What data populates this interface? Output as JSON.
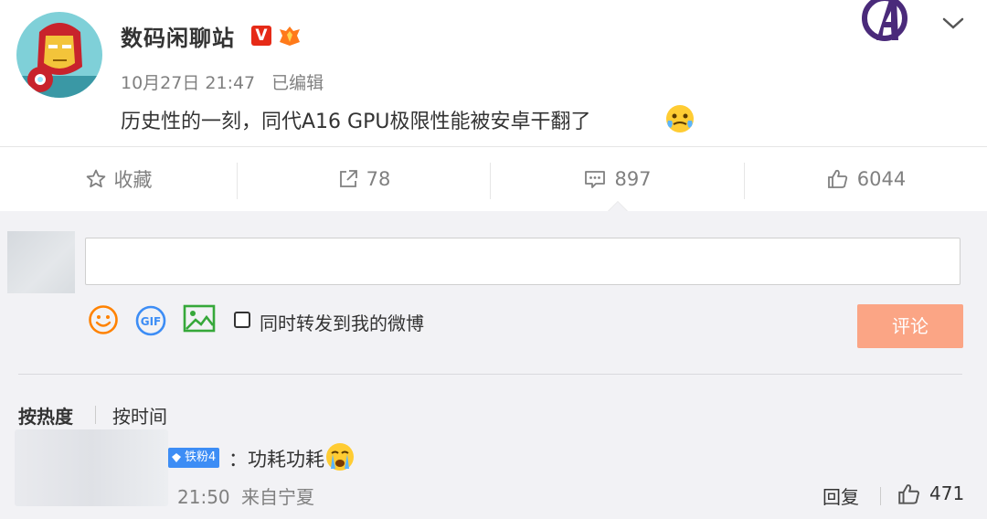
{
  "post": {
    "author": "数码闲聊站",
    "verified_badge": "V",
    "timestamp": "10月27日 21:47",
    "edited_label": "已编辑",
    "content": "历史性的一刻，同代A16 GPU极限性能被安卓干翻了"
  },
  "actions": {
    "favorite_label": "收藏",
    "repost_count": "78",
    "comment_count": "897",
    "like_count": "6044"
  },
  "composer": {
    "input_value": "",
    "repost_checkbox_label": "同时转发到我的微博",
    "repost_checked": false,
    "submit_label": "评论"
  },
  "sort": {
    "hot_label": "按热度",
    "time_label": "按时间",
    "active": "按热度"
  },
  "comment": {
    "fan_badge": "铁粉4",
    "text": "：功耗功耗",
    "time": "21:50",
    "location": "来自宁夏",
    "reply_label": "回复",
    "like_count": "471"
  },
  "colors": {
    "accent_orange": "#ff8200",
    "submit_disabled": "#fba585",
    "fan_badge_blue": "#3d8df5",
    "vip_red": "#e62a17",
    "meta_gray": "#808080"
  },
  "icons": [
    "star-icon",
    "share-icon",
    "comment-icon",
    "thumbs-up-icon",
    "emoji-icon",
    "gif-icon",
    "image-icon",
    "chevron-down-icon",
    "diamond-icon"
  ]
}
